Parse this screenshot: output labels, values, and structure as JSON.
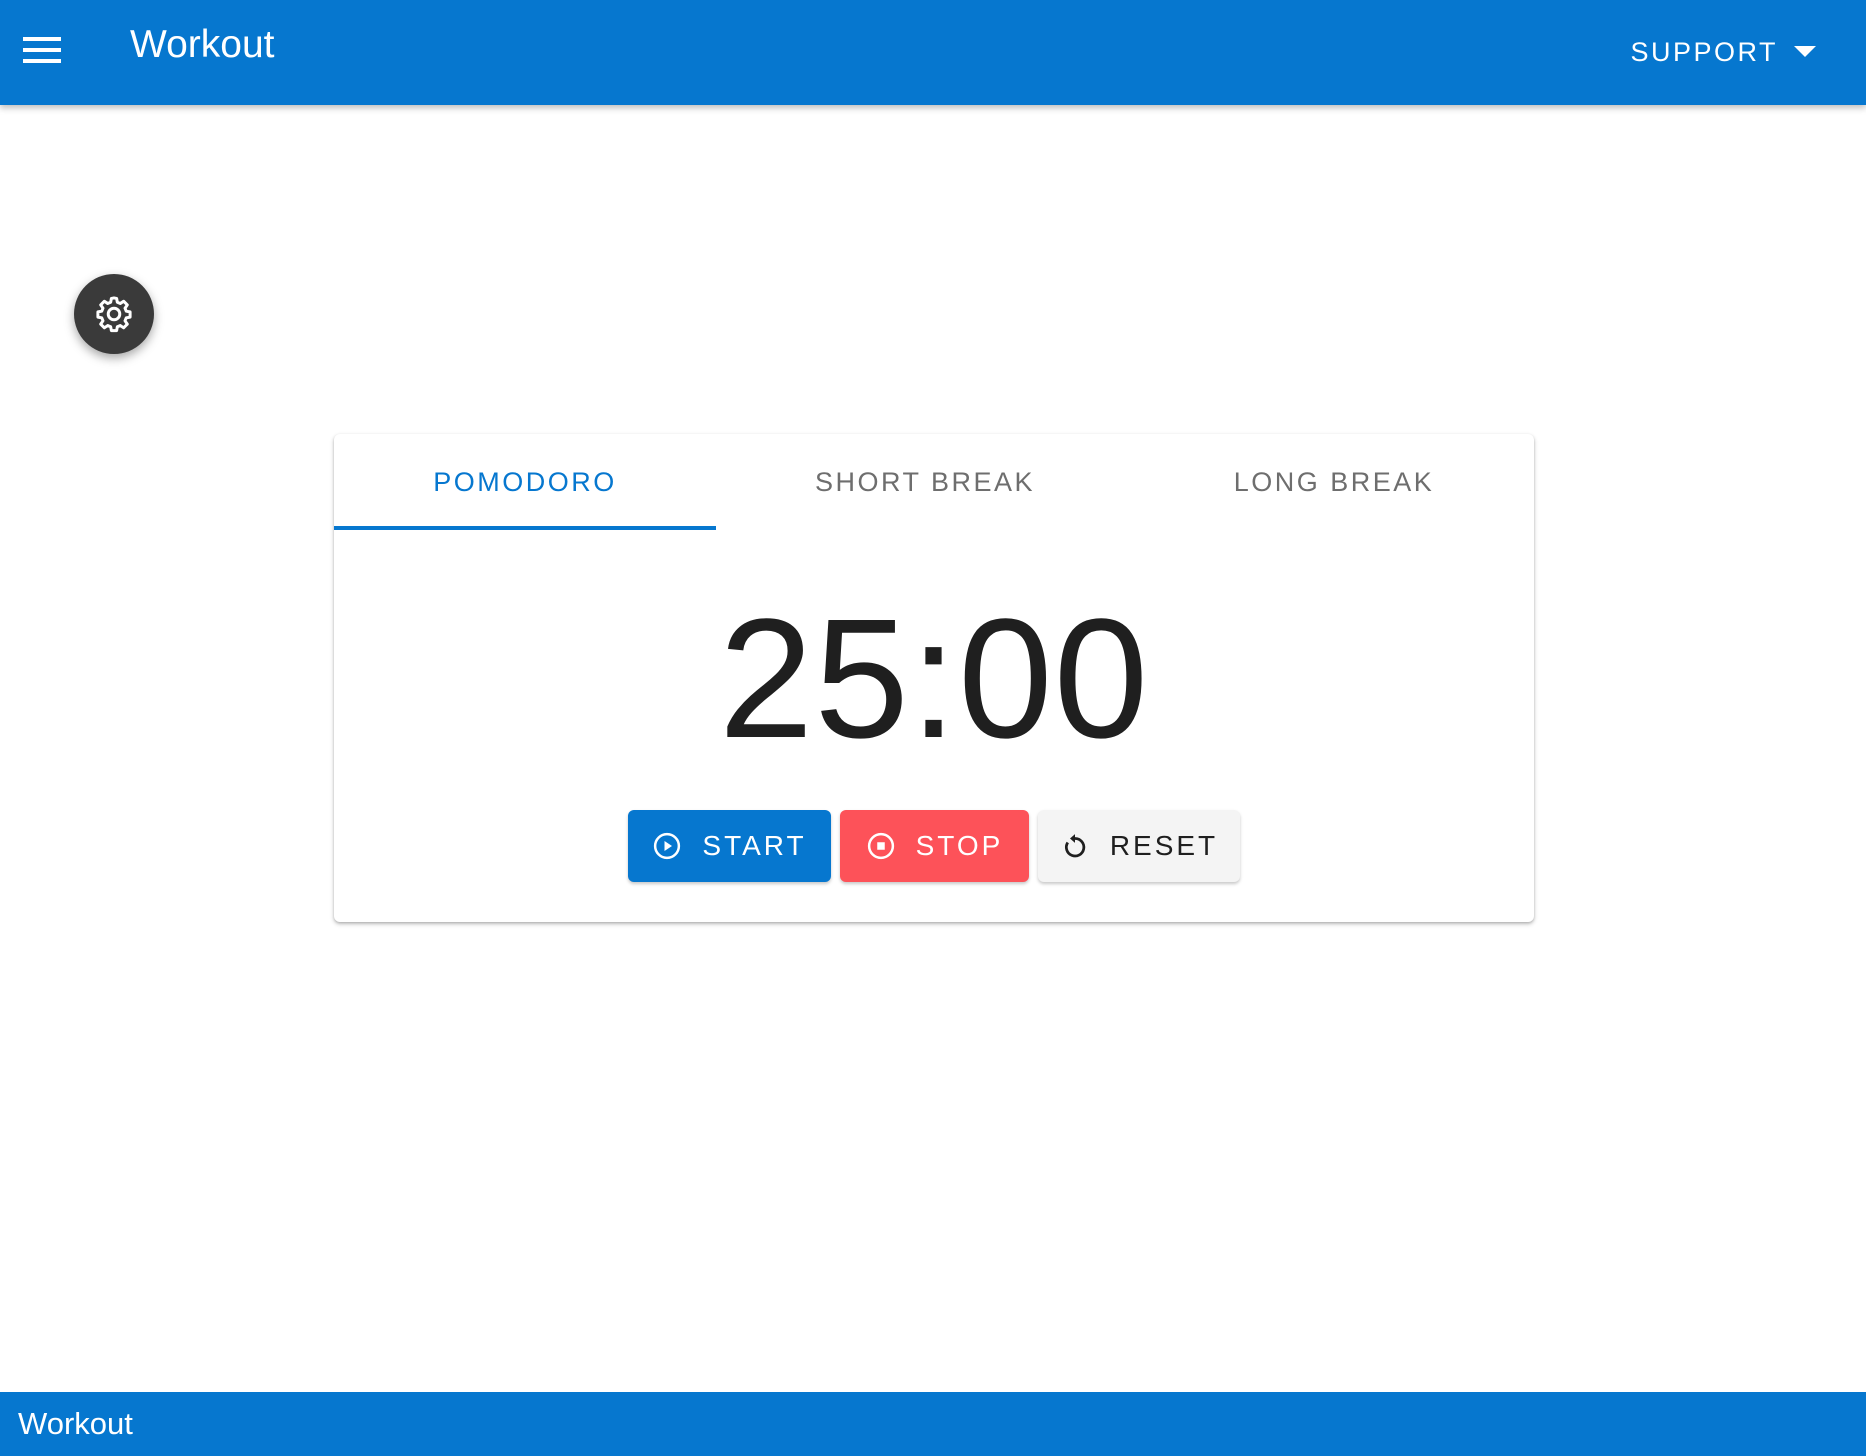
{
  "app_bar": {
    "title": "Workout",
    "menu_icon": "menu-icon",
    "support_label": "SUPPORT",
    "support_icon": "arrow-drop-down-icon",
    "color": "#0677cf"
  },
  "settings_fab": {
    "icon": "gear-icon",
    "color": "#3a3a3a"
  },
  "timer": {
    "tabs": [
      {
        "label": "POMODORO",
        "active": true
      },
      {
        "label": "SHORT BREAK",
        "active": false
      },
      {
        "label": "LONG BREAK",
        "active": false
      }
    ],
    "time": "25:00",
    "buttons": {
      "start": {
        "label": "START",
        "icon": "play-circle-icon",
        "color": "#0677cf"
      },
      "stop": {
        "label": "STOP",
        "icon": "stop-circle-icon",
        "color": "#fd5259"
      },
      "reset": {
        "label": "RESET",
        "icon": "reset-icon",
        "color": "#f4f4f4"
      }
    }
  },
  "footer": {
    "title": "Workout"
  }
}
